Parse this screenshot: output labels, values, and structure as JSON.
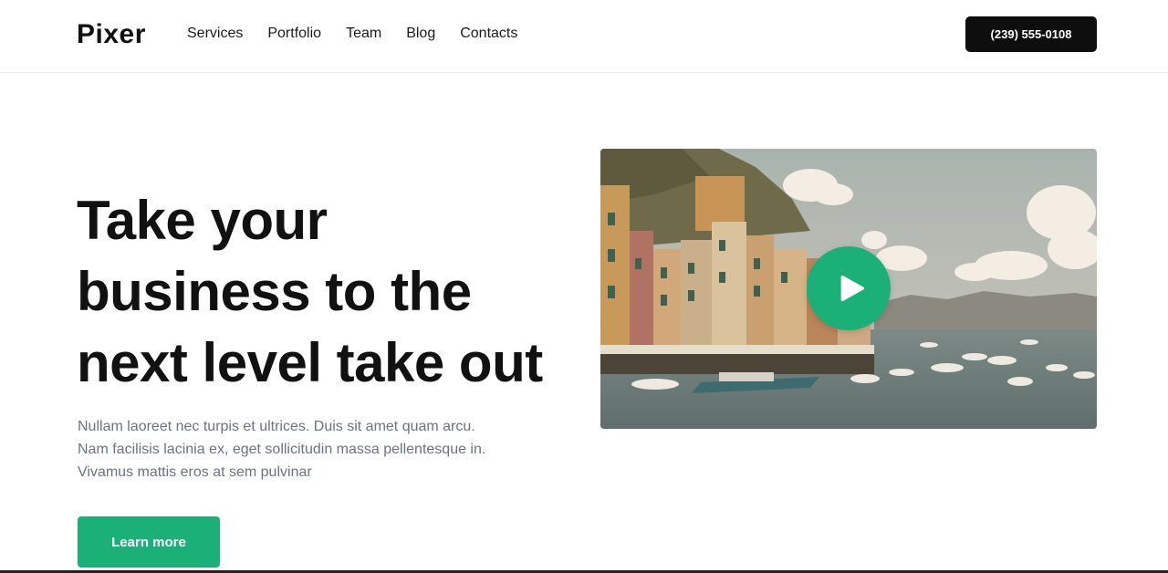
{
  "brand": {
    "logo_text": "Pixer",
    "accent": "#1bb078"
  },
  "nav": {
    "items": [
      {
        "label": "Services"
      },
      {
        "label": "Portfolio"
      },
      {
        "label": "Team"
      },
      {
        "label": "Blog"
      },
      {
        "label": "Contacts"
      }
    ]
  },
  "header": {
    "phone_label": "(239) 555-0108"
  },
  "hero": {
    "title_lines": [
      "Take your",
      "business to the",
      "next level take out"
    ],
    "description_lines": [
      "Nullam laoreet nec turpis et ultrices. Duis sit amet quam arcu.",
      "Nam facilisis lacinia ex, eget sollicitudin massa pellentesque in.",
      "Vivamus mattis eros at sem pulvinar"
    ],
    "cta_label": "Learn more"
  },
  "media": {
    "play_icon": "play-icon",
    "image_subject": "harbor-village-photo"
  }
}
